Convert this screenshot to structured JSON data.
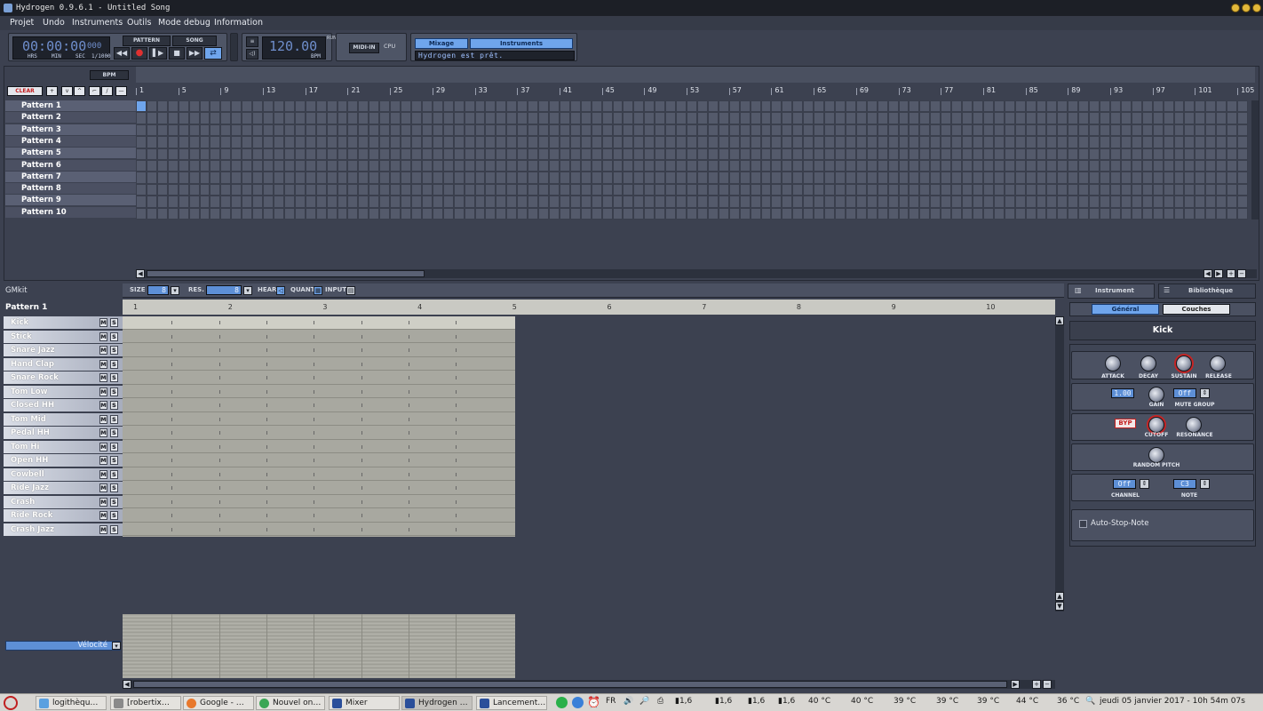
{
  "window": {
    "title": "Hydrogen 0.9.6.1 - Untitled Song"
  },
  "menu": [
    "Projet",
    "Undo",
    "Instruments",
    "Outils",
    "Mode debug",
    "Information"
  ],
  "transport": {
    "time": "00:00:00",
    "time_ms": "000",
    "time_labels": [
      "HRS",
      "MIN",
      "SEC",
      "1/1000"
    ],
    "mode_pattern": "PATTERN",
    "mode_song": "SONG",
    "bpm_value": "120.00",
    "bpm_label": "BPM",
    "run_label": "RUN",
    "midi_in": "MIDI-IN",
    "cpu": "CPU",
    "mix_button": "Mixage",
    "instruments_button": "Instruments",
    "status_message": "Hydrogen est prêt."
  },
  "song_editor": {
    "bpm_button": "BPM",
    "clear_button": "CLEAR",
    "ruler": [
      "1",
      "5",
      "9",
      "13",
      "17",
      "21",
      "25",
      "29",
      "33",
      "37",
      "41",
      "45",
      "49",
      "53",
      "57",
      "61",
      "65",
      "69",
      "73",
      "77",
      "81",
      "85",
      "89",
      "93",
      "97",
      "101",
      "105"
    ],
    "patterns": [
      "Pattern 1",
      "Pattern 2",
      "Pattern 3",
      "Pattern 4",
      "Pattern 5",
      "Pattern 6",
      "Pattern 7",
      "Pattern 8",
      "Pattern 9",
      "Pattern 10"
    ],
    "active_cells": [
      {
        "pattern": 1,
        "bar": 1
      }
    ]
  },
  "pattern_editor": {
    "kit": "GMkit",
    "current_pattern": "Pattern 1",
    "size_label": "SIZE",
    "size_value": "8",
    "res_label": "RES.",
    "res_value": "8",
    "hear_label": "HEAR",
    "quant_label": "QUANT",
    "input_label": "INPUT",
    "ruler": [
      "1",
      "2",
      "3",
      "4",
      "5",
      "6",
      "7",
      "8",
      "9",
      "10"
    ],
    "instruments": [
      "Kick",
      "Stick",
      "Snare Jazz",
      "Hand Clap",
      "Snare Rock",
      "Tom Low",
      "Closed HH",
      "Tom Mid",
      "Pedal HH",
      "Tom Hi",
      "Open HH",
      "Cowbell",
      "Ride Jazz",
      "Crash",
      "Ride Rock",
      "Crash Jazz"
    ],
    "mute_label": "M",
    "solo_label": "S",
    "velocity_label": "Vélocité"
  },
  "instrument_panel": {
    "tab_instrument": "Instrument",
    "tab_library": "Bibliothèque",
    "sub_general": "Général",
    "sub_layers": "Couches",
    "instrument_name": "Kick",
    "adsr": [
      "ATTACK",
      "DECAY",
      "SUSTAIN",
      "RELEASE"
    ],
    "gain_value": "1.00",
    "gain_label": "GAIN",
    "mute_group_value": "Off",
    "mute_group_label": "MUTE GROUP",
    "byp_label": "BYP",
    "cutoff_label": "CUTOFF",
    "resonance_label": "RESONANCE",
    "random_pitch_label": "RANDOM PITCH",
    "channel_value": "Off",
    "channel_label": "CHANNEL",
    "note_value": "C3",
    "note_label": "NOTE",
    "auto_stop_note": "Auto-Stop-Note"
  },
  "taskbar": {
    "tasks": [
      "logithèqu…",
      "[robertix…",
      "Google - …",
      "Nouvel on…",
      "Mixer",
      "Hydrogen …",
      "Lancement…"
    ],
    "active_task": 5,
    "lang": "FR",
    "cpu_readings": [
      "1,6",
      "1,6",
      "1,6",
      "1,6"
    ],
    "temps": [
      "40 °C",
      "40 °C",
      "39 °C",
      "39 °C",
      "39 °C",
      "44 °C",
      "36 °C"
    ],
    "clock": "jeudi 05 janvier 2017 - 10h 54m 07s"
  },
  "colors": {
    "accent": "#6fa5ec",
    "panel": "#3c4150",
    "knob_ring": "#c62424"
  }
}
